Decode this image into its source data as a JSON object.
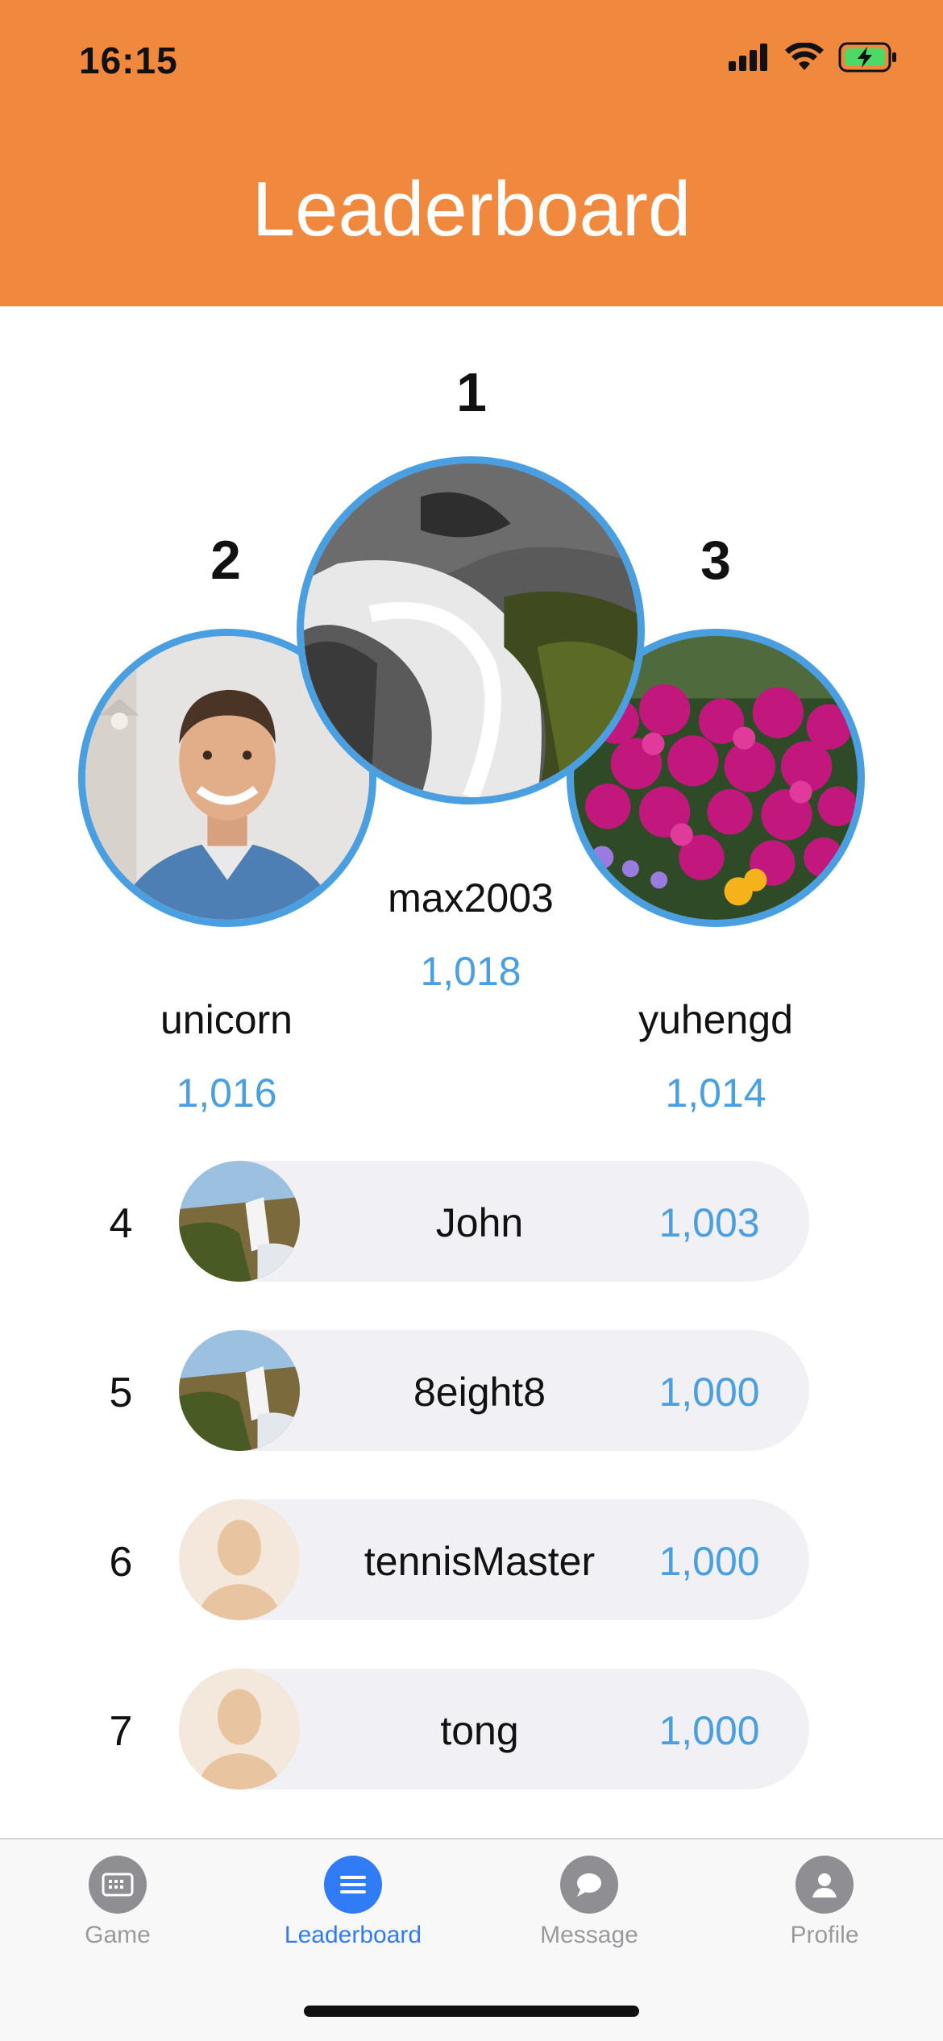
{
  "status": {
    "time": "16:15"
  },
  "header": {
    "title": "Leaderboard"
  },
  "podium": {
    "first": {
      "rank": "1",
      "name": "max2003",
      "score": "1,018"
    },
    "second": {
      "rank": "2",
      "name": "unicorn",
      "score": "1,016"
    },
    "third": {
      "rank": "3",
      "name": "yuhengd",
      "score": "1,014"
    }
  },
  "rows": [
    {
      "rank": "4",
      "name": "John",
      "score": "1,003"
    },
    {
      "rank": "5",
      "name": "8eight8",
      "score": "1,000"
    },
    {
      "rank": "6",
      "name": "tennisMaster",
      "score": "1,000"
    },
    {
      "rank": "7",
      "name": "tong",
      "score": "1,000"
    }
  ],
  "tabs": [
    {
      "label": "Game",
      "icon": "game-icon",
      "active": false
    },
    {
      "label": "Leaderboard",
      "icon": "list-icon",
      "active": true
    },
    {
      "label": "Message",
      "icon": "message-icon",
      "active": false
    },
    {
      "label": "Profile",
      "icon": "profile-icon",
      "active": false
    }
  ],
  "colors": {
    "header": "#F0893E",
    "accent": "#4A9FE0",
    "tab_active": "#2F7CF6",
    "pill": "#F1F1F5"
  }
}
